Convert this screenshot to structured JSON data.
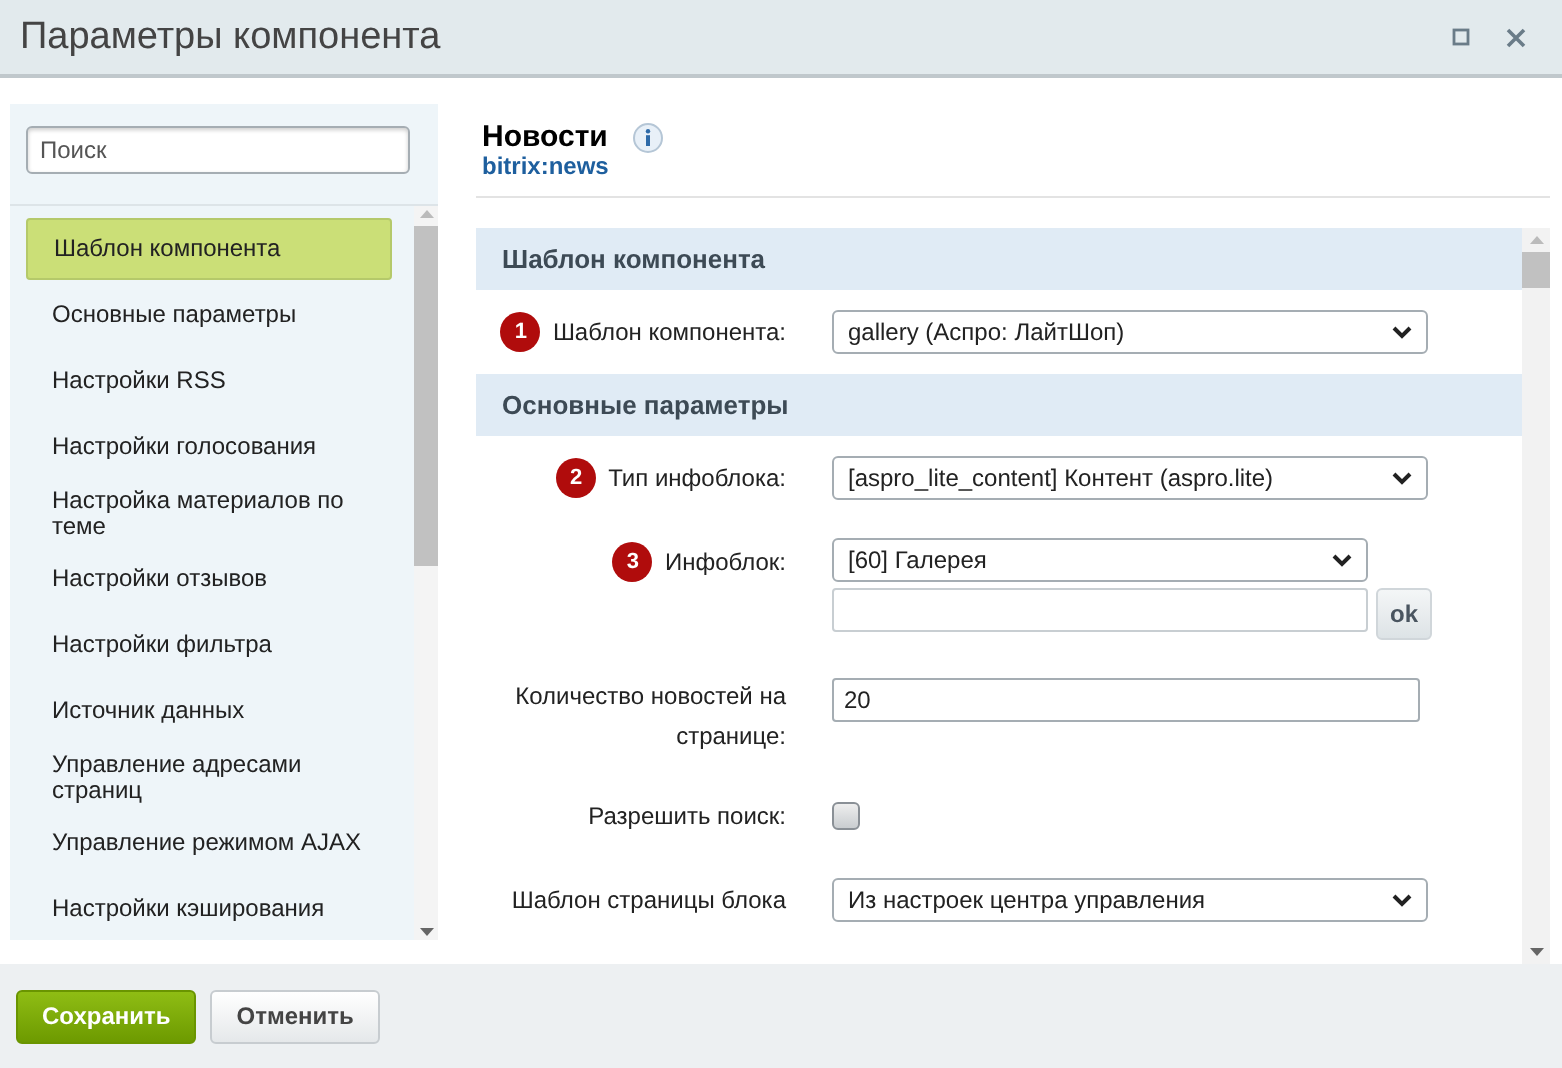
{
  "window": {
    "title": "Параметры компонента"
  },
  "search": {
    "placeholder": "Поиск"
  },
  "sidebar": {
    "items": [
      {
        "label": "Шаблон компонента",
        "selected": true
      },
      {
        "label": "Основные параметры",
        "selected": false
      },
      {
        "label": "Настройки RSS",
        "selected": false
      },
      {
        "label": "Настройки голосования",
        "selected": false
      },
      {
        "label": "Настройка материалов по теме",
        "selected": false
      },
      {
        "label": "Настройки отзывов",
        "selected": false
      },
      {
        "label": "Настройки фильтра",
        "selected": false
      },
      {
        "label": "Источник данных",
        "selected": false
      },
      {
        "label": "Управление адресами страниц",
        "selected": false
      },
      {
        "label": "Управление режимом AJAX",
        "selected": false
      },
      {
        "label": "Настройки кэширования",
        "selected": false
      }
    ]
  },
  "component": {
    "name": "Новости",
    "code": "bitrix:news"
  },
  "sections": [
    {
      "title": "Шаблон компонента",
      "fields": [
        {
          "kind": "select",
          "badge": "1",
          "label": "Шаблон компонента:",
          "value": "gallery (Аспро: ЛайтШоп)"
        }
      ]
    },
    {
      "title": "Основные параметры",
      "fields": [
        {
          "kind": "select",
          "badge": "2",
          "label": "Тип инфоблока:",
          "value": "[aspro_lite_content] Контент (aspro.lite)"
        },
        {
          "kind": "select_input",
          "badge": "3",
          "label": "Инфоблок:",
          "value": "[60] Галерея",
          "button": "ok"
        },
        {
          "kind": "text",
          "label": "Количество новостей на странице:",
          "value": "20"
        },
        {
          "kind": "checkbox",
          "label": "Разрешить поиск:",
          "checked": false
        },
        {
          "kind": "select",
          "label": "Шаблон страницы блока",
          "value": "Из настроек центра управления"
        }
      ]
    }
  ],
  "buttons": [
    {
      "label": "Сохранить",
      "kind": "primary"
    },
    {
      "label": "Отменить",
      "kind": "secondary"
    }
  ]
}
